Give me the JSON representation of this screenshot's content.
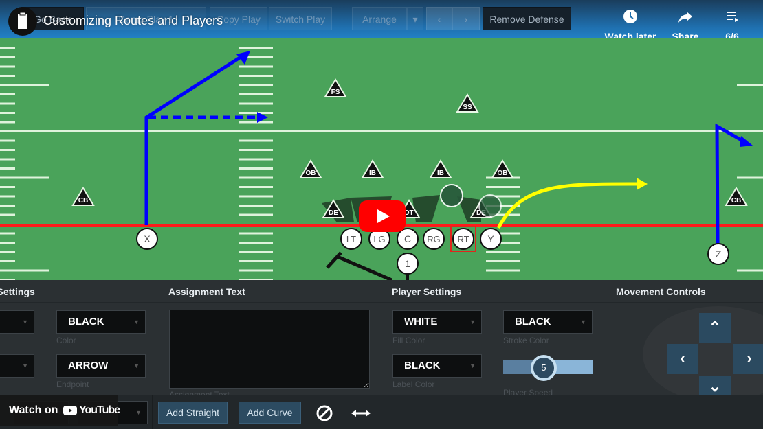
{
  "video": {
    "title": "Customizing Routes and Players",
    "actions": [
      {
        "icon": "clock-icon",
        "label": "Watch later"
      },
      {
        "icon": "share-arrow-icon",
        "label": "Share"
      },
      {
        "icon": "playlist-icon",
        "label": "6/6"
      }
    ],
    "watch_on": "Watch on",
    "youtube_brand": "YouTube"
  },
  "toolbar": {
    "go_back": "Go Back",
    "play_name": "Demo Play 1",
    "copy_play": "Copy Play",
    "switch_play": "Switch Play",
    "arrange": "Arrange",
    "remove_defense": "Remove Defense"
  },
  "field": {
    "colors": {
      "turf": "#4aa35a",
      "line_of_scrimmage": "#ff0000",
      "route_blue": "#0000ff",
      "route_yellow": "#ffff00"
    },
    "offense": [
      {
        "label": "X"
      },
      {
        "label": "LT"
      },
      {
        "label": "LG"
      },
      {
        "label": "C"
      },
      {
        "label": "RG"
      },
      {
        "label": "RT",
        "selected": true
      },
      {
        "label": "Y"
      },
      {
        "label": "1"
      },
      {
        "label": "Z"
      }
    ],
    "defense": [
      {
        "label": "FS"
      },
      {
        "label": "SS"
      },
      {
        "label": "OB"
      },
      {
        "label": "IB"
      },
      {
        "label": "IB"
      },
      {
        "label": "OB"
      },
      {
        "label": "CB"
      },
      {
        "label": "CB"
      },
      {
        "label": "DE"
      },
      {
        "label": "DT"
      },
      {
        "label": "DE"
      }
    ]
  },
  "panel": {
    "route_settings": {
      "heading": "Route Settings",
      "color_value": "BLACK",
      "color_label": "Color",
      "endpoint_value": "ARROW",
      "endpoint_label": "Endpoint"
    },
    "assignment": {
      "heading": "Assignment Text",
      "value": "",
      "label": "Assignment Text"
    },
    "player_settings": {
      "heading": "Player Settings",
      "fill_value": "WHITE",
      "fill_label": "Fill Color",
      "stroke_value": "BLACK",
      "stroke_label": "Stroke Color",
      "label_color_value": "BLACK",
      "label_color_label": "Label Color",
      "speed_value": "5",
      "speed_label": "Player Speed",
      "speed_fraction": 0.5
    },
    "movement": {
      "heading": "Movement Controls"
    }
  },
  "actions": {
    "add_straight": "Add Straight",
    "add_curve": "Add Curve"
  }
}
